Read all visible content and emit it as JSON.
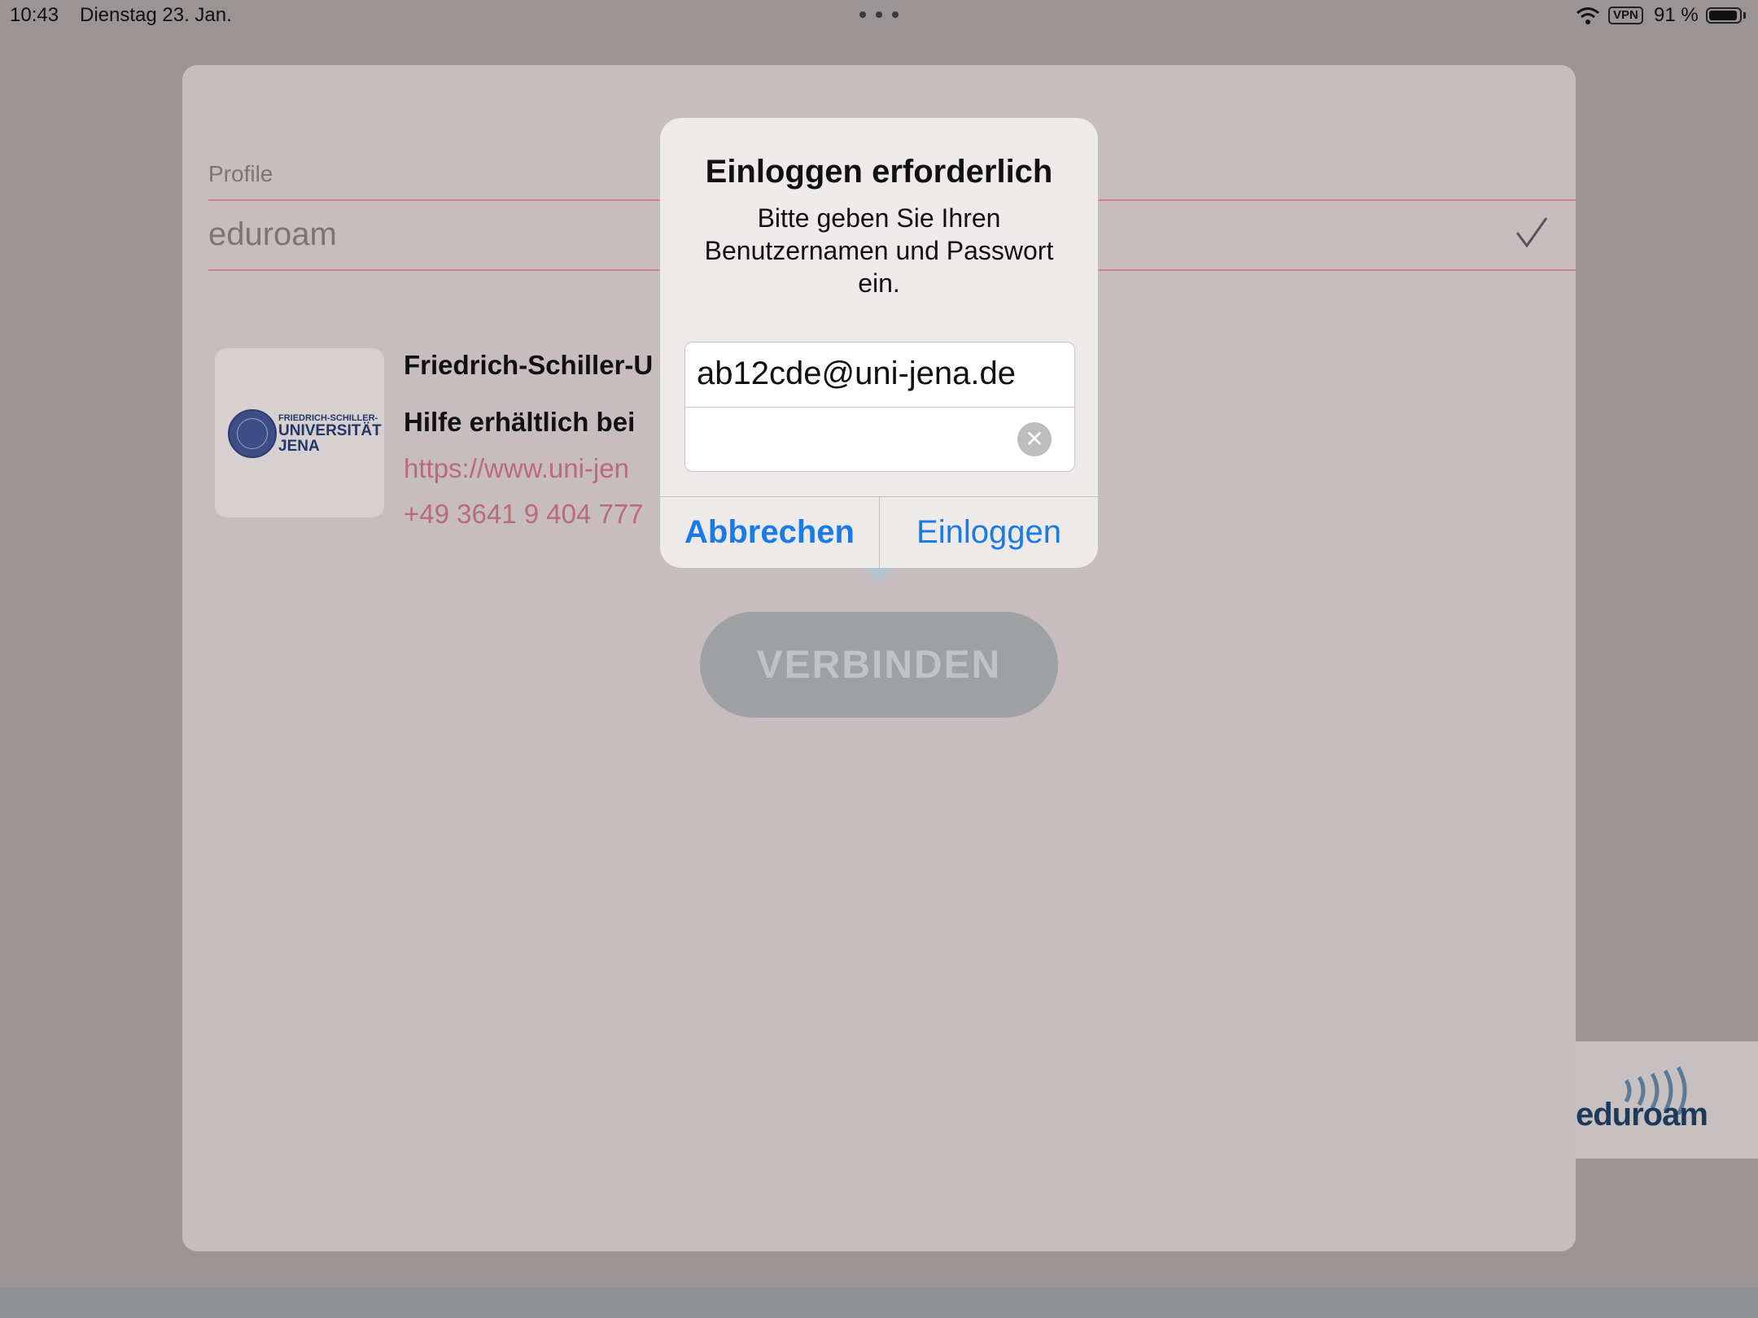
{
  "status_bar": {
    "time": "10:43",
    "date": "Dienstag 23. Jan.",
    "vpn": "VPN",
    "battery": "91 %"
  },
  "screen": {
    "profile_label": "Profile",
    "profile_value": "eduroam",
    "institution_name": "Friedrich-Schiller-U",
    "help_title": "Hilfe erhältlich bei",
    "help_url": "https://www.uni-jen",
    "help_phone": "+49 3641 9 404 777",
    "connect_label": "VERBINDEN",
    "logo": {
      "line1": "FRIEDRICH-SCHILLER-",
      "line2": "UNIVERSITÄT",
      "line3": "JENA"
    },
    "eduroam_logo": "eduroam"
  },
  "alert": {
    "title": "Einloggen erforderlich",
    "message": "Bitte geben Sie Ihren Benutzernamen und Passwort ein.",
    "username_value": "ab12cde@uni-jena.de",
    "password_value": "",
    "cancel_label": "Abbrechen",
    "login_label": "Einloggen"
  },
  "colors": {
    "accent": "#1a7ae8",
    "link": "#bb6a7c",
    "divider": "#d4808d"
  }
}
